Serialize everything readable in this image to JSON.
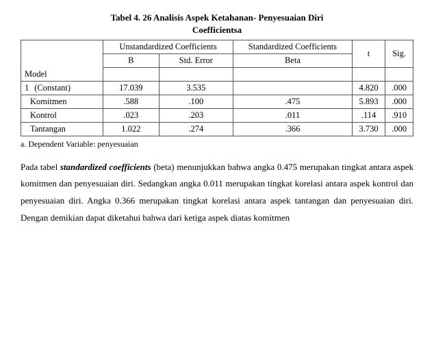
{
  "title": {
    "line1": "Tabel 4. 26 Analisis Aspek Ketahanan- Penyesuaian Diri",
    "line2": "Coefficientsa"
  },
  "table": {
    "headers": {
      "unstandardized": "Unstandardized Coefficients",
      "standardized": "Standardized Coefficients",
      "t": "t",
      "sig": "Sig."
    },
    "subheaders": {
      "model": "Model",
      "b": "B",
      "std_error": "Std. Error",
      "beta": "Beta"
    },
    "rows": [
      {
        "model_num": "1",
        "label": "(Constant)",
        "b": "17.039",
        "std_error": "3.535",
        "beta": "",
        "t": "4.820",
        "sig": ".000"
      },
      {
        "model_num": "",
        "label": "Komitmen",
        "b": ".588",
        "std_error": ".100",
        "beta": ".475",
        "t": "5.893",
        "sig": ".000"
      },
      {
        "model_num": "",
        "label": "Kontrol",
        "b": ".023",
        "std_error": ".203",
        "beta": ".011",
        "t": ".114",
        "sig": ".910"
      },
      {
        "model_num": "",
        "label": "Tantangan",
        "b": "1.022",
        "std_error": ".274",
        "beta": ".366",
        "t": "3.730",
        "sig": ".000"
      }
    ]
  },
  "note": "a. Dependent Variable: penyesuaian",
  "body": {
    "p1_before_italic": "Pada  tabel ",
    "p1_italic": "standardized  coefficients",
    "p1_after_italic": " (beta)  menunjukkan  bahwa  angka  0.475  merupakan tingkat antara aspek komitmen dan penyesuaian diri. Sedangkan angka 0.011  merupakan  tingkat  korelasi  antara  aspek  kontrol  dan    penyesuaian  diri. Angka 0.366 merupakan tingkat korelasi antara aspek tantangan dan penyesuaian diri. Dengan demikian dapat diketahui bahwa dari ketiga aspek diatas komitmen"
  }
}
